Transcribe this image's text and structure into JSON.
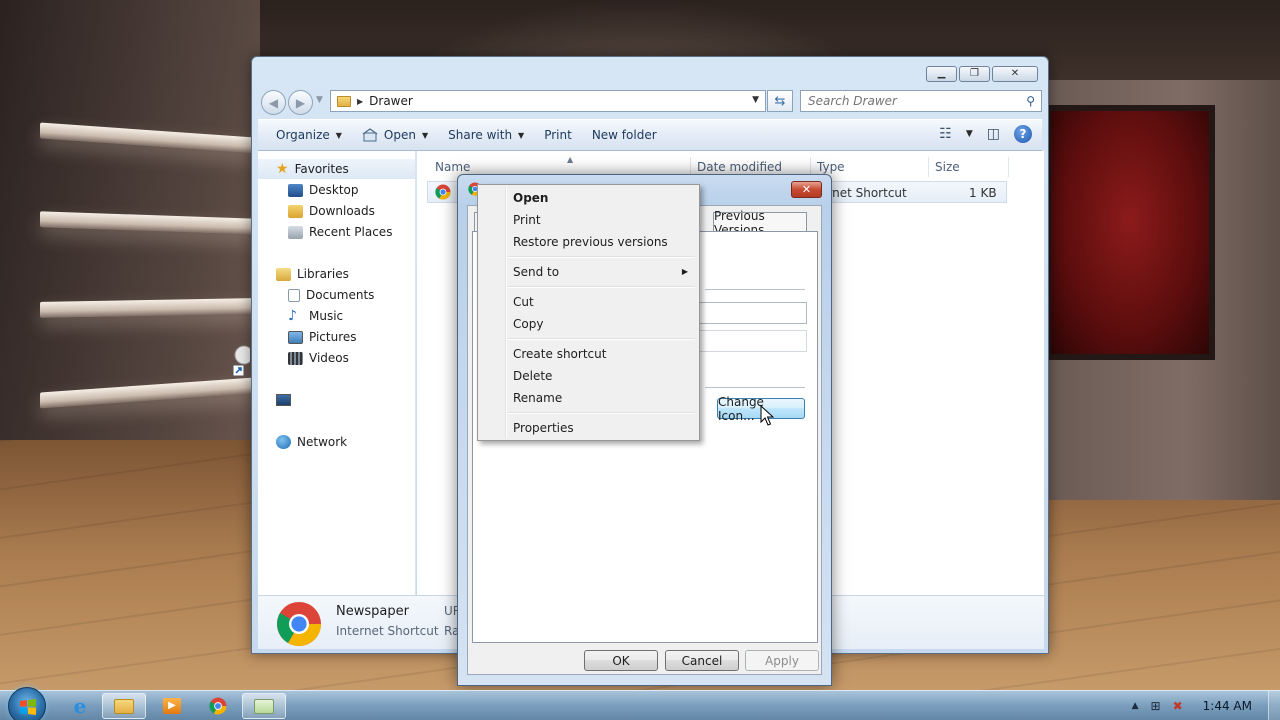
{
  "explorer": {
    "address": "Drawer",
    "search_placeholder": "Search Drawer",
    "toolbar": {
      "organize": "Organize",
      "open": "Open",
      "share_with": "Share with",
      "print": "Print",
      "new_folder": "New folder"
    },
    "nav": {
      "favorites": "Favorites",
      "desktop": "Desktop",
      "downloads": "Downloads",
      "recent_places": "Recent Places",
      "libraries": "Libraries",
      "documents": "Documents",
      "music": "Music",
      "pictures": "Pictures",
      "videos": "Videos",
      "network": "Network"
    },
    "columns": {
      "name": "Name",
      "date_modified": "Date modified",
      "type": "Type",
      "size": "Size"
    },
    "file": {
      "type_visible": "ernet Shortcut",
      "size": "1 KB"
    },
    "details": {
      "name": "Newspaper",
      "type": "Internet Shortcut",
      "key1": "UR",
      "key2": "Ratin"
    }
  },
  "dialog": {
    "tab_previous_versions": "Previous Versions",
    "change_icon": "Change Icon...",
    "ok": "OK",
    "cancel": "Cancel",
    "apply": "Apply"
  },
  "context_menu": {
    "open": "Open",
    "print": "Print",
    "restore": "Restore previous versions",
    "send_to": "Send to",
    "cut": "Cut",
    "copy": "Copy",
    "create_shortcut": "Create shortcut",
    "delete": "Delete",
    "rename": "Rename",
    "properties": "Properties"
  },
  "taskbar": {
    "clock": "1:44 AM"
  },
  "colors": {
    "accent": "#3c7fb1",
    "window_frame": "#c6d9ee"
  }
}
